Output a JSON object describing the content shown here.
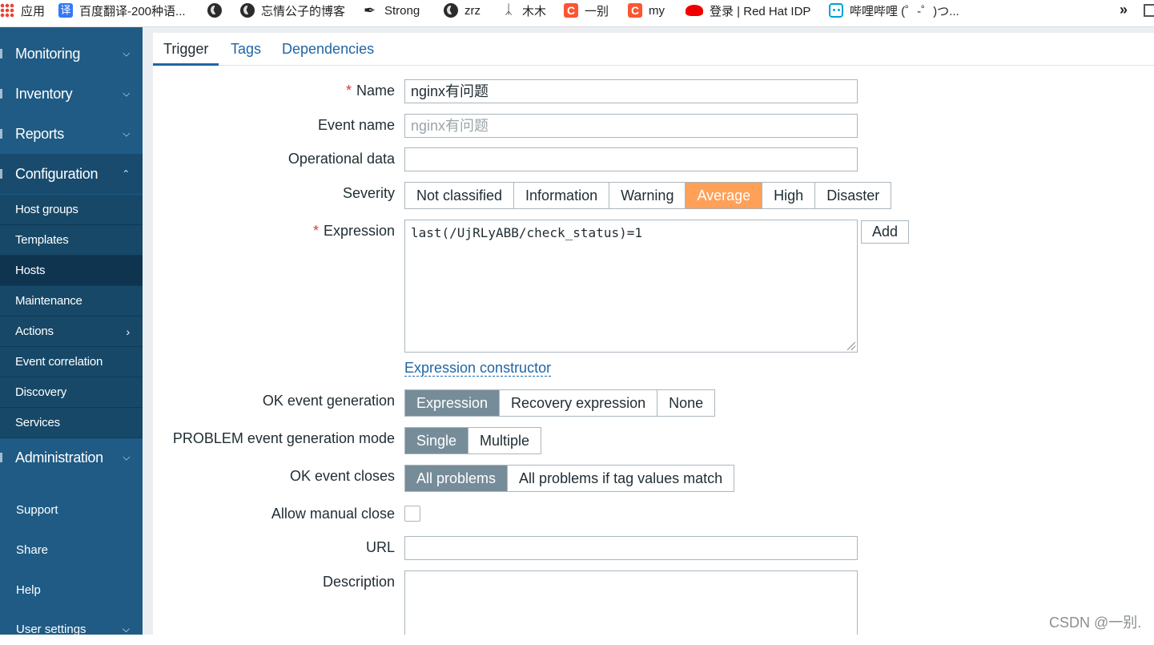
{
  "bookmarks": [
    {
      "icon": "apps-grid-icon",
      "label": "应用"
    },
    {
      "icon": "baidu-fanyi-icon",
      "label": "百度翻译-200种语..."
    },
    {
      "icon": "globe-icon",
      "label": ""
    },
    {
      "icon": "globe-icon",
      "label": "忘情公子的博客"
    },
    {
      "icon": "strong-icon",
      "label": "Strong"
    },
    {
      "icon": "globe-icon",
      "label": "zrz"
    },
    {
      "icon": "mumu-icon",
      "label": "木木"
    },
    {
      "icon": "csdn-icon",
      "label": "一别"
    },
    {
      "icon": "csdn-icon",
      "label": "my"
    },
    {
      "icon": "redhat-icon",
      "label": "登录 | Red Hat IDP"
    },
    {
      "icon": "bilibili-icon",
      "label": "哔哩哔哩 (゜-゜)つ..."
    }
  ],
  "bookmarks_more": "»",
  "sidebar": {
    "monitoring": "Monitoring",
    "inventory": "Inventory",
    "reports": "Reports",
    "configuration": "Configuration",
    "config_items": [
      "Host groups",
      "Templates",
      "Hosts",
      "Maintenance",
      "Actions",
      "Event correlation",
      "Discovery",
      "Services"
    ],
    "administration": "Administration",
    "support": "Support",
    "share": "Share",
    "help": "Help",
    "user_settings": "User settings"
  },
  "tabs": [
    "Trigger",
    "Tags",
    "Dependencies"
  ],
  "form": {
    "name_label": "Name",
    "name_value": "nginx有问题",
    "event_name_label": "Event name",
    "event_name_placeholder": "nginx有问题",
    "operational_data_label": "Operational data",
    "operational_data_value": "",
    "severity_label": "Severity",
    "severity_options": [
      "Not classified",
      "Information",
      "Warning",
      "Average",
      "High",
      "Disaster"
    ],
    "severity_selected": "Average",
    "expression_label": "Expression",
    "expression_value": "last(/UjRLyABB/check_status)=1",
    "add_button": "Add",
    "expression_constructor": "Expression constructor",
    "ok_event_generation_label": "OK event generation",
    "ok_event_generation_options": [
      "Expression",
      "Recovery expression",
      "None"
    ],
    "ok_event_generation_selected": "Expression",
    "problem_mode_label": "PROBLEM event generation mode",
    "problem_mode_options": [
      "Single",
      "Multiple"
    ],
    "problem_mode_selected": "Single",
    "ok_event_closes_label": "OK event closes",
    "ok_event_closes_options": [
      "All problems",
      "All problems if tag values match"
    ],
    "ok_event_closes_selected": "All problems",
    "allow_manual_close_label": "Allow manual close",
    "allow_manual_close_checked": false,
    "url_label": "URL",
    "url_value": "",
    "description_label": "Description",
    "description_value": ""
  },
  "watermark": "CSDN @一别.",
  "colors": {
    "sidebar": "#1f5b84",
    "severity_average": "#ffa059",
    "segment_selected": "#768d99",
    "link": "#1f65a6",
    "required": "#e33734"
  }
}
